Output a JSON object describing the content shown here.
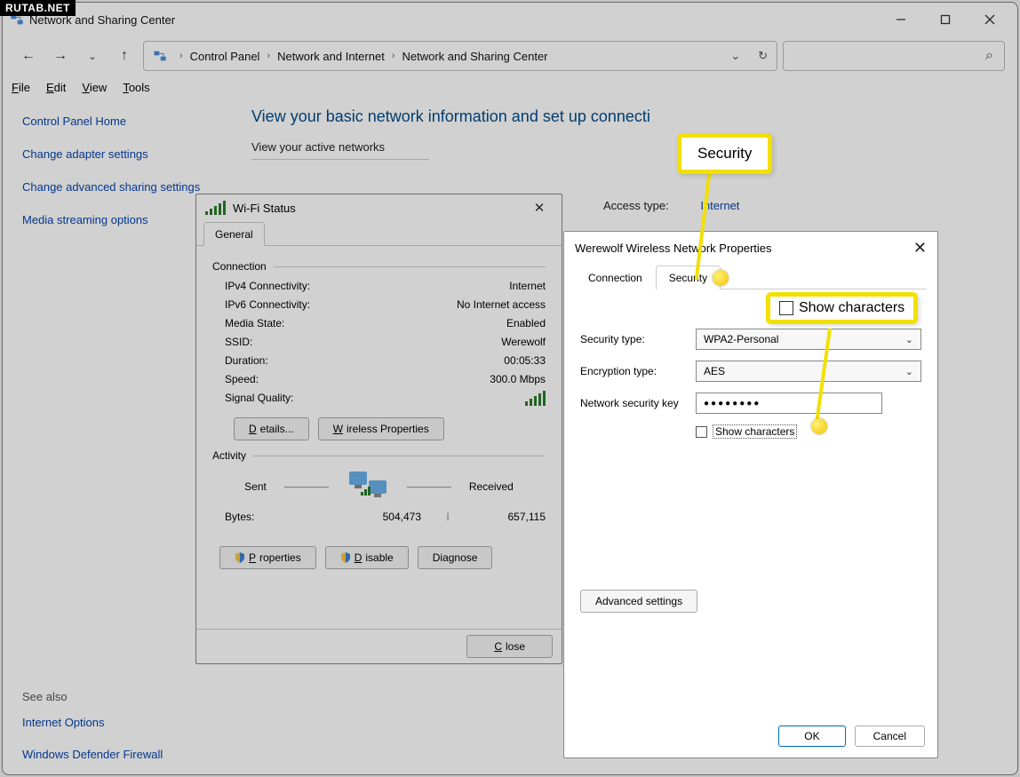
{
  "brand": "RUTAB.NET",
  "window": {
    "title": "Network and Sharing Center"
  },
  "breadcrumb": {
    "root": "Control Panel",
    "level1": "Network and Internet",
    "level2": "Network and Sharing Center"
  },
  "menubar": {
    "file": "File",
    "edit": "Edit",
    "view": "View",
    "tools": "Tools"
  },
  "sidebar": {
    "home": "Control Panel Home",
    "adapter": "Change adapter settings",
    "sharing": "Change advanced sharing settings",
    "streaming": "Media streaming options",
    "see_also": "See also",
    "inet_opts": "Internet Options",
    "firewall": "Windows Defender Firewall"
  },
  "main": {
    "heading": "View your basic network information and set up connecti",
    "active_nets": "View your active networks",
    "access_type_label": "Access type:",
    "access_type_value": "Internet"
  },
  "wifi": {
    "title": "Wi-Fi Status",
    "tab_general": "General",
    "group_conn": "Connection",
    "ipv4_label": "IPv4 Connectivity:",
    "ipv4_value": "Internet",
    "ipv6_label": "IPv6 Connectivity:",
    "ipv6_value": "No Internet access",
    "media_label": "Media State:",
    "media_value": "Enabled",
    "ssid_label": "SSID:",
    "ssid_value": "Werewolf",
    "dur_label": "Duration:",
    "dur_value": "00:05:33",
    "speed_label": "Speed:",
    "speed_value": "300.0 Mbps",
    "sigq_label": "Signal Quality:",
    "btn_details": "Details...",
    "btn_wprops": "Wireless Properties",
    "group_act": "Activity",
    "sent": "Sent",
    "received": "Received",
    "bytes_label": "Bytes:",
    "bytes_sent": "504,473",
    "bytes_recv": "657,115",
    "btn_props": "Properties",
    "btn_disable": "Disable",
    "btn_diag": "Diagnose",
    "btn_close": "Close"
  },
  "props": {
    "title": "Werewolf Wireless Network Properties",
    "tab_conn": "Connection",
    "tab_sec": "Security",
    "sectype_label": "Security type:",
    "sectype_value": "WPA2-Personal",
    "enctype_label": "Encryption type:",
    "enctype_value": "AES",
    "key_label": "Network security key",
    "key_value": "●●●●●●●●",
    "show_chars": "Show characters",
    "adv_btn": "Advanced settings",
    "ok": "OK",
    "cancel": "Cancel"
  },
  "callouts": {
    "security": "Security",
    "show_chars": "Show characters"
  }
}
